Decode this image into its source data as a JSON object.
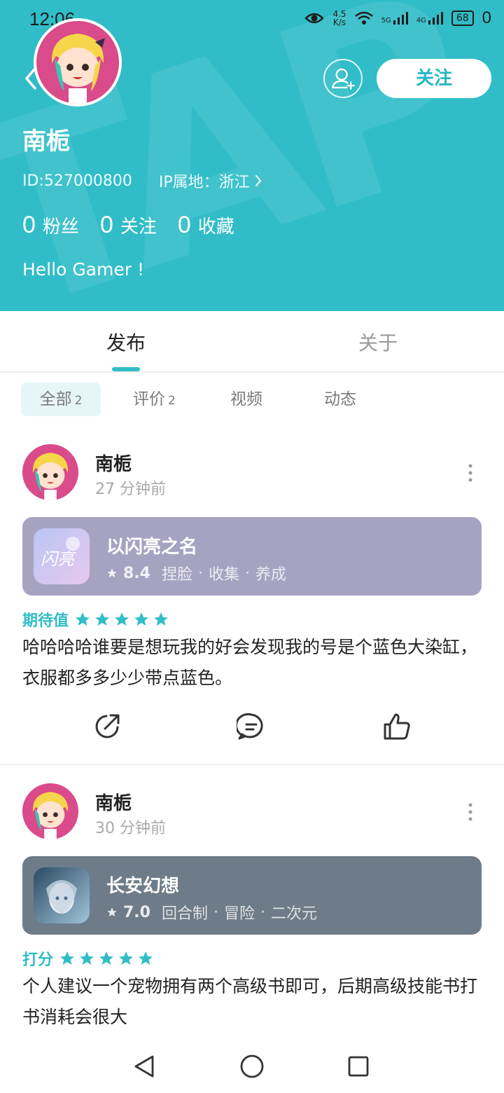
{
  "status_bar": {
    "time": "12:06",
    "network_speed": "4.5\nK/s",
    "signal_1": "5G",
    "signal_2": "4G",
    "battery": "68",
    "notifications": "0"
  },
  "profile": {
    "username": "南栀",
    "id_text": "ID:527000800",
    "ip_text": "IP属地：浙江",
    "follow_label": "关注",
    "bio": "Hello Gamer !",
    "stats": [
      {
        "num": "0",
        "label": "粉丝"
      },
      {
        "num": "0",
        "label": "关注"
      },
      {
        "num": "0",
        "label": "收藏"
      }
    ]
  },
  "tabs": {
    "publish": "发布",
    "about": "关于"
  },
  "filters": {
    "all_label": "全部",
    "all_count": "2",
    "review_label": "评价",
    "review_count": "2",
    "video_label": "视频",
    "moment_label": "动态"
  },
  "posts": [
    {
      "author": "南栀",
      "time": "27 分钟前",
      "game": {
        "title": "以闪亮之名",
        "score": "8.4",
        "tags": [
          "捏脸",
          "收集",
          "养成"
        ]
      },
      "rating_label": "期待值",
      "rating_stars": 5,
      "text": "哈哈哈哈谁要是想玩我的好会发现我的号是个蓝色大染缸，衣服都多多少少带点蓝色。"
    },
    {
      "author": "南栀",
      "time": "30 分钟前",
      "game": {
        "title": "长安幻想",
        "score": "7.0",
        "tags": [
          "回合制",
          "冒险",
          "二次元"
        ]
      },
      "rating_label": "打分",
      "rating_stars": 5,
      "text": "个人建议一个宠物拥有两个高级书即可，后期高级技能书打书消耗会很大"
    }
  ],
  "colors": {
    "header": "#31bdc8",
    "accent": "#31bdc8",
    "card_1": "#a6a3c1",
    "card_2": "#6d7c88"
  },
  "icons": [
    "back-icon",
    "add-friend-icon",
    "more-icon",
    "star-icon",
    "share-icon",
    "comment-icon",
    "like-icon",
    "nav-back-icon",
    "nav-home-icon",
    "nav-recents-icon"
  ]
}
